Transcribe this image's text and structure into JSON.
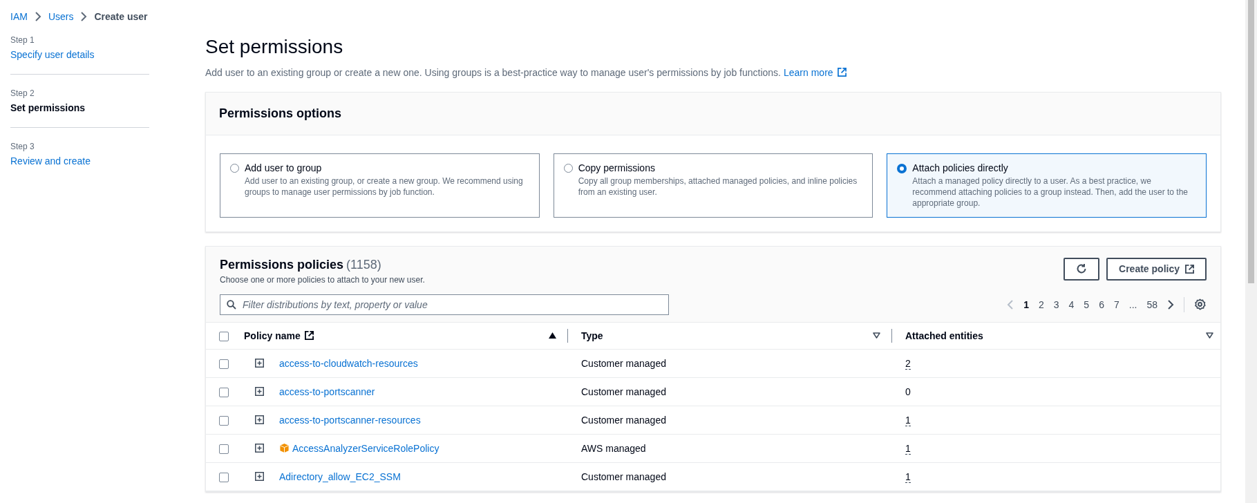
{
  "breadcrumb": [
    {
      "label": "IAM",
      "kind": "link"
    },
    {
      "label": "Users",
      "kind": "link"
    },
    {
      "label": "Create user",
      "kind": "current"
    }
  ],
  "steps": [
    {
      "step": "Step 1",
      "label": "Specify user details",
      "selected": false
    },
    {
      "step": "Step 2",
      "label": "Set permissions",
      "selected": true
    },
    {
      "step": "Step 3",
      "label": "Review and create",
      "selected": false
    }
  ],
  "page": {
    "title": "Set permissions",
    "description": "Add user to an existing group or create a new one. Using groups is a best-practice way to manage user's permissions by job functions.",
    "learn_more": "Learn more"
  },
  "permissions_options": {
    "title": "Permissions options",
    "options": [
      {
        "label": "Add user to group",
        "description": "Add user to an existing group, or create a new group. We recommend using groups to manage user permissions by job function.",
        "selected": false
      },
      {
        "label": "Copy permissions",
        "description": "Copy all group memberships, attached managed policies, and inline policies from an existing user.",
        "selected": false
      },
      {
        "label": "Attach policies directly",
        "description": "Attach a managed policy directly to a user. As a best practice, we recommend attaching policies to a group instead. Then, add the user to the appropriate group.",
        "selected": true
      }
    ]
  },
  "policies": {
    "title": "Permissions policies",
    "count": "(1158)",
    "subtitle": "Choose one or more policies to attach to your new user.",
    "create_button": "Create policy",
    "search": {
      "placeholder": "Filter distributions by text, property or value"
    },
    "pages": [
      {
        "label": "1",
        "selected": true
      },
      {
        "label": "2",
        "selected": false
      },
      {
        "label": "3",
        "selected": false
      },
      {
        "label": "4",
        "selected": false
      },
      {
        "label": "5",
        "selected": false
      },
      {
        "label": "6",
        "selected": false
      },
      {
        "label": "7",
        "selected": false
      },
      {
        "label": "...",
        "selected": false
      },
      {
        "label": "58",
        "selected": false
      }
    ],
    "select_all_checked": false,
    "columns": [
      {
        "label": "Policy name",
        "sorted": true,
        "external": true
      },
      {
        "label": "Type",
        "sorted": false,
        "external": false
      },
      {
        "label": "Attached entities",
        "sorted": false,
        "external": false
      }
    ],
    "rows": [
      {
        "name": "access-to-cloudwatch-resources",
        "type": "Customer managed",
        "attached": "2",
        "popover": true,
        "kind": "customer",
        "checked": false
      },
      {
        "name": "access-to-portscanner",
        "type": "Customer managed",
        "attached": "0",
        "popover": false,
        "kind": "customer",
        "checked": false
      },
      {
        "name": "access-to-portscanner-resources",
        "type": "Customer managed",
        "attached": "1",
        "popover": true,
        "kind": "customer",
        "checked": false
      },
      {
        "name": "AccessAnalyzerServiceRolePolicy",
        "type": "AWS managed",
        "attached": "1",
        "popover": true,
        "kind": "aws",
        "checked": false
      },
      {
        "name": "Adirectory_allow_EC2_SSM",
        "type": "Customer managed",
        "attached": "1",
        "popover": true,
        "kind": "customer",
        "checked": false
      }
    ]
  }
}
